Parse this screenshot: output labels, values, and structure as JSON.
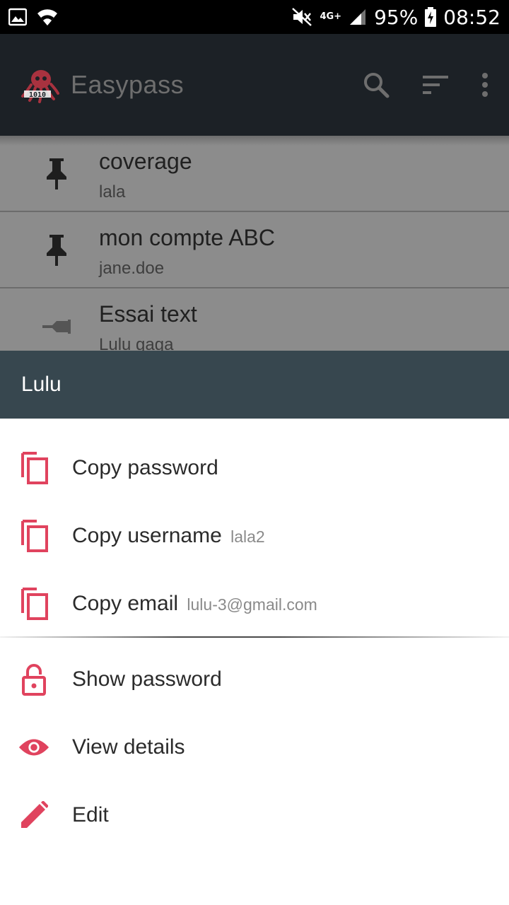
{
  "status_bar": {
    "network_label": "4G+",
    "battery": "95%",
    "time": "08:52"
  },
  "app_bar": {
    "title": "Easypass",
    "icons": [
      "search-icon",
      "sort-icon",
      "more-vert-icon"
    ]
  },
  "list": {
    "items": [
      {
        "title": "coverage",
        "subtitle": "lala",
        "pinned": true
      },
      {
        "title": "mon compte ABC",
        "subtitle": "jane.doe",
        "pinned": true
      },
      {
        "title": "Essai text",
        "subtitle": "Lulu gaga",
        "pinned": false
      }
    ]
  },
  "sheet": {
    "title": "Lulu",
    "accent_color": "#e0435e",
    "actions": [
      {
        "label": "Copy password",
        "extra": "",
        "icon": "copy-icon"
      },
      {
        "label": "Copy username",
        "extra": "lala2",
        "icon": "copy-icon"
      },
      {
        "label": "Copy email",
        "extra": "lulu-3@gmail.com",
        "icon": "copy-icon"
      },
      {
        "label": "Show password",
        "extra": "",
        "icon": "lock-open-icon"
      },
      {
        "label": "View details",
        "extra": "",
        "icon": "eye-icon"
      },
      {
        "label": "Edit",
        "extra": "",
        "icon": "pencil-icon"
      }
    ]
  }
}
